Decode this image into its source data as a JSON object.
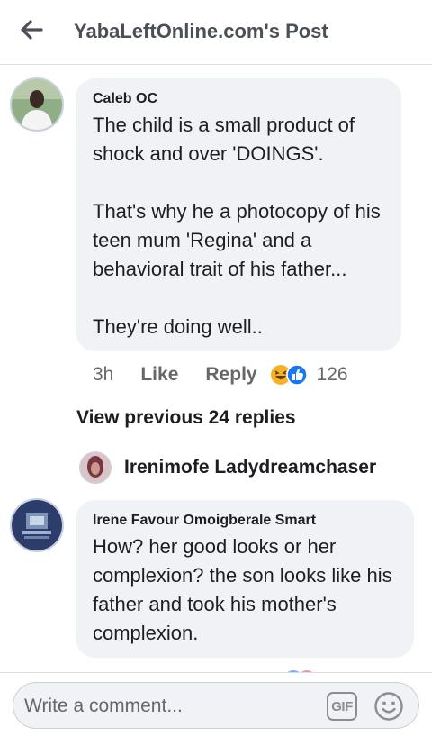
{
  "header": {
    "title": "YabaLeftOnline.com's Post",
    "back_icon": "back-arrow-icon"
  },
  "comment": {
    "author": "Caleb OC",
    "text": "The child is a small product of shock and over 'DOINGS'.\n\nThat's why he a photocopy of his teen mum 'Regina' and a behavioral trait of his father...\n\nThey're doing well..",
    "time": "3h",
    "like_label": "Like",
    "reply_label": "Reply",
    "reactions": [
      "haha-reaction-icon",
      "like-reaction-icon"
    ],
    "reaction_count": "126"
  },
  "view_previous": "View previous 24 replies",
  "reply_preview": {
    "author": "Irenimofe Ladydreamchaser"
  },
  "reply": {
    "author": "Irene Favour Omoigberale Smart",
    "text": "How? her good looks or her complexion? the son looks like his father and took his mother's complexion."
  },
  "composer": {
    "placeholder": "Write a comment...",
    "gif_label": "GIF",
    "emoji_icon": "smiley-icon"
  },
  "colors": {
    "bubble": "#f0f2f5",
    "secondary_text": "#65676b",
    "primary_text": "#1c1e21",
    "like_blue": "#1877f2",
    "haha_yellow": "#f7b125"
  }
}
